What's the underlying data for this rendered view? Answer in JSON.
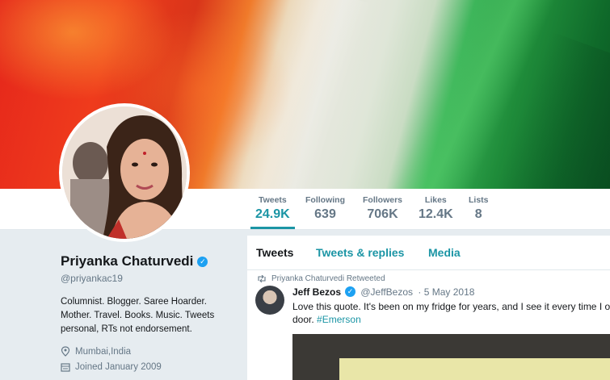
{
  "profile": {
    "name": "Priyanka Chaturvedi",
    "handle": "@priyankac19",
    "bio": "Columnist. Blogger. Saree Hoarder. Mother. Travel. Books. Music. Tweets personal, RTs not endorsement.",
    "location": "Mumbai,India",
    "joined": "Joined January 2009"
  },
  "stats": [
    {
      "label": "Tweets",
      "value": "24.9K"
    },
    {
      "label": "Following",
      "value": "639"
    },
    {
      "label": "Followers",
      "value": "706K"
    },
    {
      "label": "Likes",
      "value": "12.4K"
    },
    {
      "label": "Lists",
      "value": "8"
    }
  ],
  "tabs": [
    "Tweets",
    "Tweets & replies",
    "Media"
  ],
  "tweet": {
    "retweet_note": "Priyanka Chaturvedi Retweeted",
    "author": "Jeff Bezos",
    "author_handle": "@JeffBezos",
    "date": "· 5 May 2018",
    "text_line1": "Love this quote. It's been on my fridge for years, and I see it every time I open th",
    "text_line2": "door.",
    "hashtag": "#Emerson"
  },
  "colors": {
    "accent": "#1b95a5",
    "verified": "#1da1f2",
    "muted": "#657786"
  },
  "icons": [
    "verified-badge-icon",
    "location-pin-icon",
    "calendar-icon",
    "retweet-icon"
  ]
}
